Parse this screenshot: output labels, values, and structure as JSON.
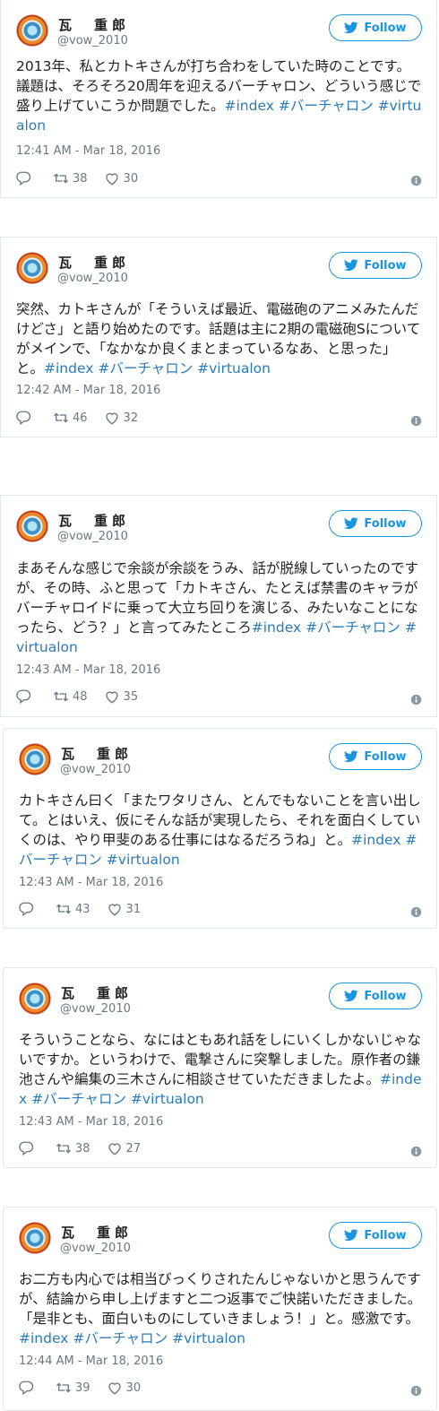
{
  "colors": {
    "accent": "#1b95e0",
    "hashtag": "#2b7bb9",
    "meta": "#697882"
  },
  "tweets": [
    {
      "user": {
        "name": "瓦　重郎",
        "handle": "@vow_2010",
        "avatar": "avatar-image"
      },
      "follow_label": "Follow",
      "text": "2013年、私とカトキさんが打ち合わをしていた時のことです。議題は、そろそろ20周年を迎えるバーチャロン、どういう感じで盛り上げていこうか問題でした。",
      "hashtags": [
        "#index",
        "#バーチャロン",
        "#virtualon"
      ],
      "time": "12:41 AM - Mar 18, 2016",
      "retweets": "38",
      "likes": "30"
    },
    {
      "user": {
        "name": "瓦　重郎",
        "handle": "@vow_2010",
        "avatar": "avatar-image"
      },
      "follow_label": "Follow",
      "text": "突然、カトキさんが「そういえば最近、電磁砲のアニメみたんだけどさ」と語り始めたのです。話題は主に2期の電磁砲Sについてがメインで、「なかなか良くまとまっているなあ、と思った」と。",
      "hashtags": [
        "#index",
        "#バーチャロン",
        "#virtualon"
      ],
      "time": "12:42 AM - Mar 18, 2016",
      "retweets": "46",
      "likes": "32"
    },
    {
      "user": {
        "name": "瓦　重郎",
        "handle": "@vow_2010",
        "avatar": "avatar-image"
      },
      "follow_label": "Follow",
      "text": "まあそんな感じで余談が余談をうみ、話が脱線していったのですが、その時、ふと思って「カトキさん、たとえば禁書のキャラがバーチャロイドに乗って大立ち回りを演じる、みたいなことになったら、どう？」と言ってみたところ",
      "hashtags": [
        "#index",
        "#バーチャロン",
        "#virtualon"
      ],
      "time": "12:43 AM - Mar 18, 2016",
      "retweets": "48",
      "likes": "35"
    },
    {
      "user": {
        "name": "瓦　重郎",
        "handle": "@vow_2010",
        "avatar": "avatar-image"
      },
      "follow_label": "Follow",
      "text": "カトキさん曰く「またワタリさん、とんでもないことを言い出して。とはいえ、仮にそんな話が実現したら、それを面白くしていくのは、やり甲斐のある仕事にはなるだろうね」と。",
      "hashtags": [
        "#index",
        "#バーチャロン",
        "#virtualon"
      ],
      "time": "12:43 AM - Mar 18, 2016",
      "retweets": "43",
      "likes": "31"
    },
    {
      "user": {
        "name": "瓦　重郎",
        "handle": "@vow_2010",
        "avatar": "avatar-image"
      },
      "follow_label": "Follow",
      "text": "そういうことなら、なにはともあれ話をしにいくしかないじゃないですか。というわけで、電撃さんに突撃しました。原作者の鎌池さんや編集の三木さんに相談させていただきましたよ。",
      "hashtags": [
        "#index",
        "#バーチャロン",
        "#virtualon"
      ],
      "time": "12:43 AM - Mar 18, 2016",
      "retweets": "38",
      "likes": "27"
    },
    {
      "user": {
        "name": "瓦　重郎",
        "handle": "@vow_2010",
        "avatar": "avatar-image"
      },
      "follow_label": "Follow",
      "text": "お二方も内心では相当びっくりされたんじゃないかと思うんですが、結論から申し上げますと二つ返事でご快諾いただきました。「是非とも、面白いものにしていきましょう！」と。感激です。",
      "hashtags": [
        "#index",
        "#バーチャロン",
        "#virtualon"
      ],
      "time": "12:44 AM - Mar 18, 2016",
      "retweets": "39",
      "likes": "30"
    }
  ]
}
